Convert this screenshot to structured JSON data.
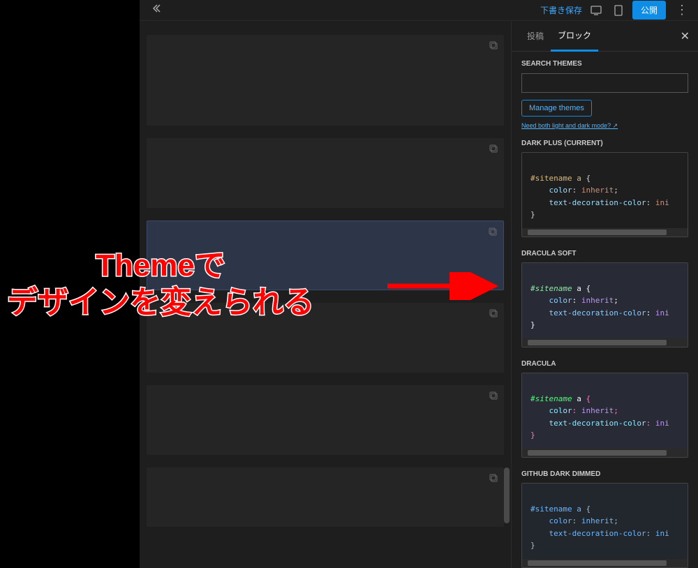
{
  "topbar": {
    "draft_save": "下書き保存",
    "publish": "公開"
  },
  "sidebar": {
    "tabs": {
      "post": "投稿",
      "block": "ブロック"
    },
    "search_label": "SEARCH THEMES",
    "manage_themes": "Manage themes",
    "help_link": "Need both light and dark mode? ↗",
    "themes": [
      {
        "label": "DARK PLUS (CURRENT)",
        "class": "darkplus",
        "code": {
          "line1_sel": "#sitename a",
          "line1_b": " {",
          "line2_p": "    color",
          "line2_c": ": ",
          "line2_v": "inherit",
          "line2_e": ";",
          "line3_p": "    text-decoration-color",
          "line3_c": ": ",
          "line3_v": "ini",
          "line4": "}"
        }
      },
      {
        "label": "DRACULA SOFT",
        "class": "draculasoft",
        "code": {
          "line1_sel": "#sitename",
          "line1_sel2": " a",
          "line1_b": " {",
          "line2_p": "    color",
          "line2_c": ": ",
          "line2_v": "inherit",
          "line2_e": ";",
          "line3_p": "    text-decoration-color",
          "line3_c": ": ",
          "line3_v": "ini",
          "line4": "}"
        }
      },
      {
        "label": "DRACULA",
        "class": "dracula",
        "code": {
          "line1_sel": "#sitename",
          "line1_sel2": " a",
          "line1_b": " {",
          "line2_p": "    color",
          "line2_c": ": ",
          "line2_v": "inherit",
          "line2_e": ";",
          "line3_p": "    text-decoration-color",
          "line3_c": ": ",
          "line3_v": "ini",
          "line4": "}"
        }
      },
      {
        "label": "GITHUB DARK DIMMED",
        "class": "ghdark",
        "code": {
          "line1_sel": "#sitename a",
          "line1_b": " {",
          "line2_p": "    color",
          "line2_c": ": ",
          "line2_v": "inherit",
          "line2_e": ";",
          "line3_p": "    text-decoration-color",
          "line3_c": ": ",
          "line3_v": "ini",
          "line4": "}"
        }
      }
    ]
  },
  "annotation": {
    "line1": "Themeで",
    "line2": "デザインを変えられる"
  }
}
